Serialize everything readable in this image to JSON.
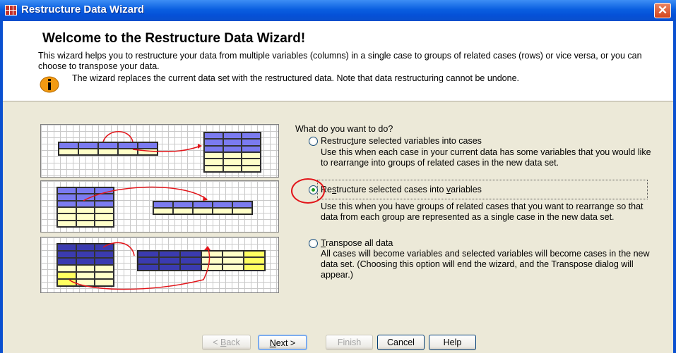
{
  "window": {
    "title": "Restructure Data Wizard",
    "close_label": "✕"
  },
  "header": {
    "heading": "Welcome to the Restructure Data Wizard!",
    "intro": "This wizard helps you to restructure your data from multiple variables (columns) in a single case to groups of related cases (rows) or vice versa, or you can choose to transpose your data.",
    "note": "The wizard replaces the current data set with the restructured data.  Note that data restructuring cannot be undone."
  },
  "question": "What do you want to do?",
  "options": [
    {
      "label": "Restructure selected variables into cases",
      "selected": false,
      "description": "Use this when each case in your current data has some variables that you would like to rearrange into groups of related cases in the new data set."
    },
    {
      "label": "Restructure selected cases into variables",
      "selected": true,
      "description": "Use this when you have groups of related cases that you want to rearrange so that data from each group are represented as a single case in the new data set."
    },
    {
      "label": "Transpose all data",
      "selected": false,
      "description": "All cases will become variables and selected variables will become cases in the new data set. (Choosing this option will end the wizard, and the Transpose dialog will appear.)"
    }
  ],
  "buttons": {
    "back": "< Back",
    "next": "Next >",
    "finish": "Finish",
    "cancel": "Cancel",
    "help": "Help"
  },
  "colors": {
    "title_bar": "#0a5fe0",
    "highlight_circle": "#e2151a",
    "table_header": "#7b7bf0",
    "table_row": "#ffffc8"
  }
}
